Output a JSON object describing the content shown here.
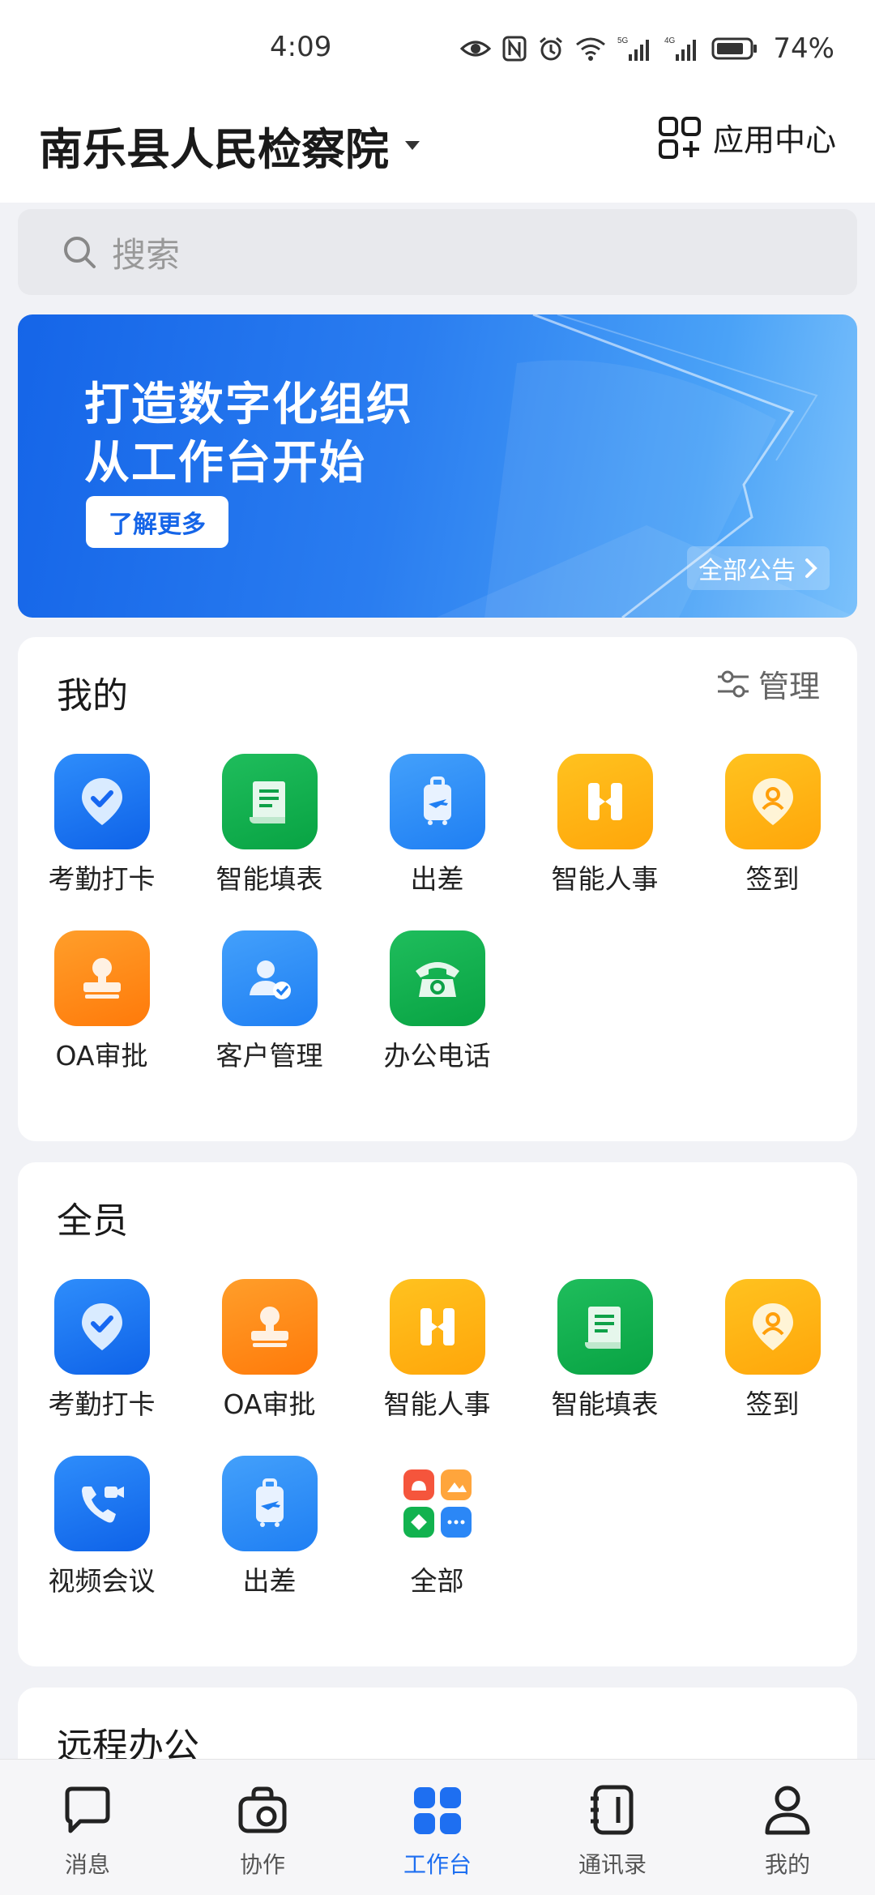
{
  "status_bar": {
    "time": "4:09",
    "battery": "74%"
  },
  "header": {
    "org_name": "南乐县人民检察院",
    "app_center_label": "应用中心"
  },
  "search": {
    "placeholder": "搜索"
  },
  "banner": {
    "line1": "打造数字化组织",
    "line2": "从工作台开始",
    "more_label": "了解更多",
    "all_notice_label": "全部公告"
  },
  "mine": {
    "title": "我的",
    "manage_label": "管理",
    "apps": [
      {
        "label": "考勤打卡",
        "icon": "check-location-icon",
        "color": "#1677ff"
      },
      {
        "label": "智能填表",
        "icon": "form-scroll-icon",
        "color": "#12b24f"
      },
      {
        "label": "出差",
        "icon": "suitcase-plane-icon",
        "color": "#2b87f6"
      },
      {
        "label": "智能人事",
        "icon": "h-logo-icon",
        "color": "#ffb214"
      },
      {
        "label": "签到",
        "icon": "person-pin-icon",
        "color": "#ffb214"
      },
      {
        "label": "OA审批",
        "icon": "stamp-icon",
        "color": "#ff8a16"
      },
      {
        "label": "客户管理",
        "icon": "customer-check-icon",
        "color": "#2b87f6"
      },
      {
        "label": "办公电话",
        "icon": "telephone-icon",
        "color": "#12b24f"
      }
    ]
  },
  "all_staff": {
    "title": "全员",
    "apps": [
      {
        "label": "考勤打卡",
        "icon": "check-location-icon",
        "color": "#1677ff"
      },
      {
        "label": "OA审批",
        "icon": "stamp-icon",
        "color": "#ff8a16"
      },
      {
        "label": "智能人事",
        "icon": "h-logo-icon",
        "color": "#ffb214"
      },
      {
        "label": "智能填表",
        "icon": "form-scroll-icon",
        "color": "#12b24f"
      },
      {
        "label": "签到",
        "icon": "person-pin-icon",
        "color": "#ffb214"
      },
      {
        "label": "视频会议",
        "icon": "video-call-icon",
        "color": "#1677ff"
      },
      {
        "label": "出差",
        "icon": "suitcase-plane-icon",
        "color": "#2b87f6"
      },
      {
        "label": "全部",
        "icon": "all-apps-icon",
        "color": "#f5553c"
      }
    ]
  },
  "remote": {
    "title": "远程办公"
  },
  "bottom_nav": [
    {
      "label": "消息",
      "icon": "chat-bubble-icon",
      "active": false
    },
    {
      "label": "协作",
      "icon": "collab-bag-icon",
      "active": false
    },
    {
      "label": "工作台",
      "icon": "workbench-grid-icon",
      "active": true
    },
    {
      "label": "通讯录",
      "icon": "contacts-book-icon",
      "active": false
    },
    {
      "label": "我的",
      "icon": "person-icon",
      "active": false
    }
  ],
  "colors": {
    "accent": "#1e6ff1",
    "background": "#f1f2f6"
  }
}
